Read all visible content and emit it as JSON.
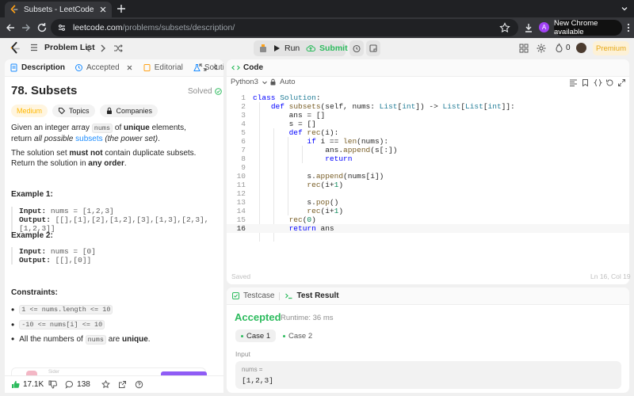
{
  "browser": {
    "tab_title": "Subsets - LeetCode",
    "url_host": "leetcode.com",
    "url_path": "/problems/subsets/description/",
    "profile_initial": "A",
    "new_chrome": "New Chrome available"
  },
  "topbar": {
    "problem_list": "Problem List",
    "run": "Run",
    "submit": "Submit",
    "streak": "0",
    "premium": "Premium"
  },
  "left_tabs": [
    {
      "label": "Description"
    },
    {
      "label": "Accepted"
    },
    {
      "label": "Editorial"
    },
    {
      "label": "Solutions"
    }
  ],
  "problem": {
    "title": "78. Subsets",
    "solved": "Solved",
    "difficulty": "Medium",
    "topics": "Topics",
    "companies": "Companies",
    "p1": {
      "a": "Given an integer array ",
      "code": "nums",
      "b": " of ",
      "bold": "unique",
      "c": " elements, return ",
      "italic": "all possible",
      "link": "subsets",
      "italic2": " (the power set)",
      "end": "."
    },
    "p2": {
      "a": "The solution set ",
      "bold": "must not",
      "b": " contain duplicate subsets. Return the solution in ",
      "bold2": "any order",
      "end": "."
    },
    "example1": {
      "head": "Example 1:",
      "input_label": "Input:",
      "input": "nums = [1,2,3]",
      "output_label": "Output:",
      "output": "[[],[1],[2],[1,2],[3],[1,3],[2,3],[1,2,3]]"
    },
    "example2": {
      "head": "Example 2:",
      "input_label": "Input:",
      "input": "nums = [0]",
      "output_label": "Output:",
      "output": "[[],[0]]"
    },
    "constraints_head": "Constraints:",
    "constraint1": "1 <= nums.length <= 10",
    "constraint2": "-10 <= nums[i] <= 10",
    "constraint3": {
      "a": "All the numbers of ",
      "code": "nums",
      "b": " are ",
      "bold": "unique",
      "end": "."
    },
    "promo_text": "Sider"
  },
  "footer": {
    "likes": "17.1K",
    "comments": "138"
  },
  "code_panel": {
    "tab": "Code",
    "language": "Python3",
    "mode": "Auto",
    "saved": "Saved",
    "position": "Ln 16, Col 19"
  },
  "code": [
    "class Solution:",
    "    def subsets(self, nums: List[int]) -> List[List[int]]:",
    "        ans = []",
    "        s = []",
    "        def rec(i):",
    "            if i == len(nums):",
    "                ans.append(s[:])",
    "                return",
    "",
    "            s.append(nums[i])",
    "            rec(i+1)",
    "",
    "            s.pop()",
    "            rec(i+1)",
    "        rec(0)",
    "        return ans"
  ],
  "result_panel": {
    "testcase_tab": "Testcase",
    "result_tab": "Test Result",
    "status": "Accepted",
    "runtime": "Runtime: 36 ms",
    "case1": "Case 1",
    "case2": "Case 2",
    "input_label": "Input",
    "var_name": "nums =",
    "var_value": "[1,2,3]"
  },
  "colors": {
    "accent": "#2cbb5d",
    "medium": "#ffb800",
    "premium": "#e6a817",
    "keyword": "#0000ff"
  }
}
